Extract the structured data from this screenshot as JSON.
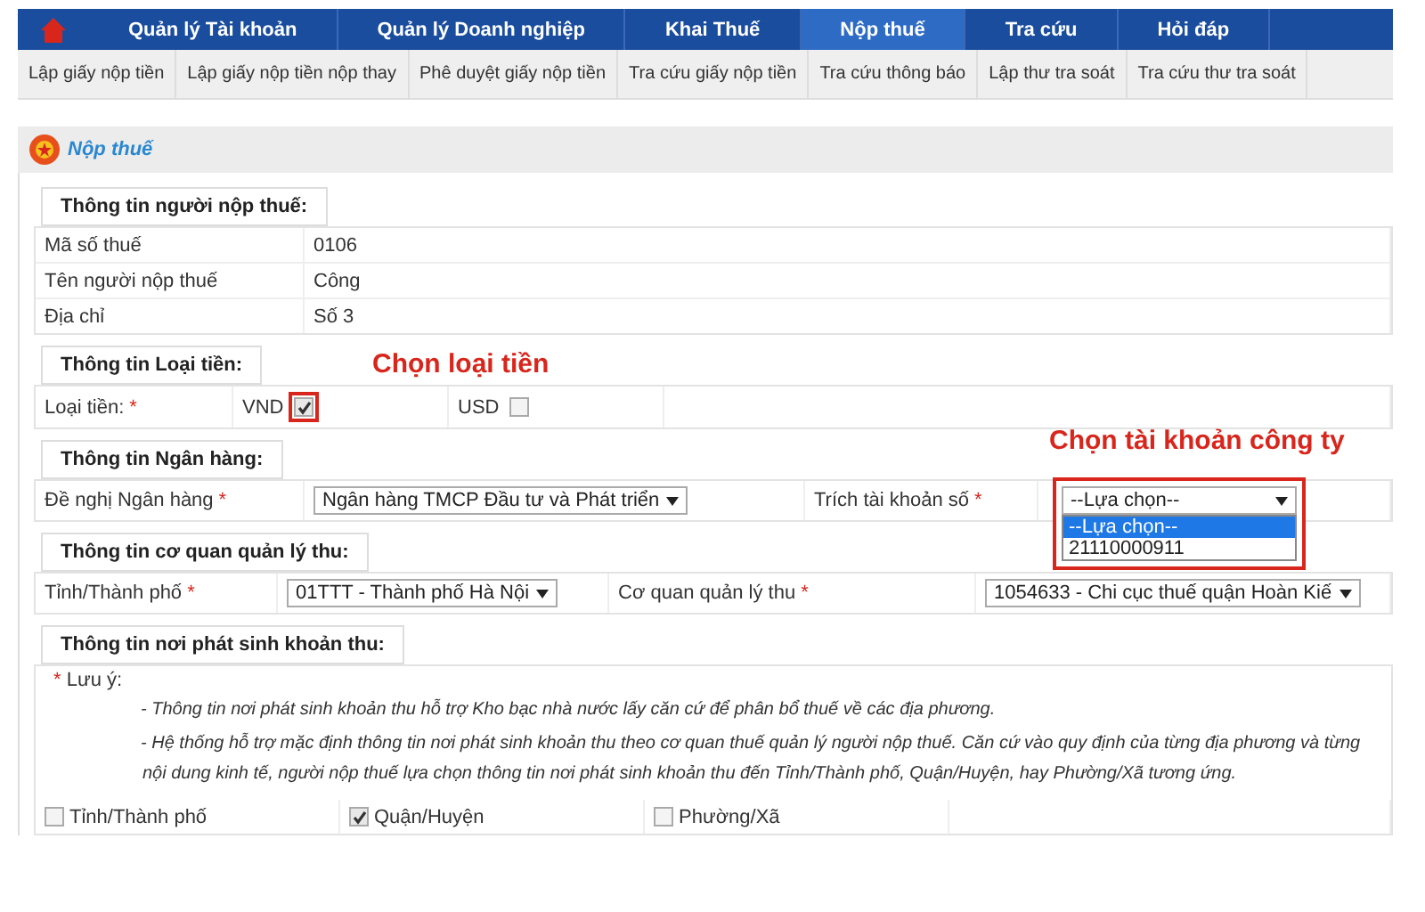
{
  "nav": {
    "items": [
      {
        "label": "Quản lý Tài khoản",
        "selected": false
      },
      {
        "label": "Quản lý Doanh nghiệp",
        "selected": false
      },
      {
        "label": "Khai Thuế",
        "selected": false
      },
      {
        "label": "Nộp thuế",
        "selected": true
      },
      {
        "label": "Tra cứu",
        "selected": false
      },
      {
        "label": "Hỏi đáp",
        "selected": false
      }
    ]
  },
  "subnav": [
    "Lập giấy nộp tiền",
    "Lập giấy nộp tiền nộp thay",
    "Phê duyệt giấy nộp tiền",
    "Tra cứu giấy nộp tiền",
    "Tra cứu thông báo",
    "Lập thư tra soát",
    "Tra cứu thư tra soát"
  ],
  "page_title": "Nộp thuế",
  "taxpayer": {
    "title": "Thông tin người nộp thuế:",
    "rows": [
      {
        "label": "Mã số thuế",
        "value": "0106"
      },
      {
        "label": "Tên người nộp thuế",
        "value": "Công"
      },
      {
        "label": "Địa chỉ",
        "value": "Số 3"
      }
    ]
  },
  "currency": {
    "title": "Thông tin Loại tiền:",
    "label": "Loại tiền:",
    "mark": "*",
    "annotation": "Chọn loại tiền",
    "options": [
      {
        "label": "VND",
        "checked": true
      },
      {
        "label": "USD",
        "checked": false
      }
    ]
  },
  "bank": {
    "title": "Thông tin Ngân hàng:",
    "annotation": "Chọn tài khoản công ty",
    "bank_field": {
      "label": "Đề nghị Ngân hàng",
      "mark": "*",
      "value": "Ngân hàng TMCP Đầu tư và Phát triển"
    },
    "account_field": {
      "label": "Trích tài khoản số",
      "mark": "*",
      "value": "--Lựa chọn--",
      "options": [
        {
          "label": "--Lựa chọn--",
          "selected": true
        },
        {
          "label": "21110000911",
          "selected": false
        }
      ]
    }
  },
  "agency": {
    "title": "Thông tin cơ quan quản lý thu:",
    "fields": [
      {
        "label": "Tỉnh/Thành phố",
        "mark": "*",
        "value": "01TTT - Thành phố Hà Nội"
      },
      {
        "label": "Cơ quan quản lý thu",
        "mark": "*",
        "value": "1054633 - Chi cục thuế quận Hoàn Kiế"
      }
    ]
  },
  "origin": {
    "title": "Thông tin nơi phát sinh khoản thu:",
    "note_mark": "*",
    "note_label": "Lưu ý:",
    "notes": [
      "- Thông tin nơi phát sinh khoản thu hỗ trợ Kho bạc nhà nước lấy căn cứ để phân bổ thuế về các địa phương.",
      "- Hệ thống hỗ trợ mặc định thông tin nơi phát sinh khoản thu theo cơ quan thuế quản lý người nộp thuế. Căn cứ vào quy định của từng địa phương và từng nội dung kinh tế, người nộp thuế lựa chọn thông tin nơi phát sinh khoản thu đến Tỉnh/Thành phố, Quận/Huyện, hay Phường/Xã tương ứng."
    ],
    "options": [
      {
        "label": "Tỉnh/Thành phố",
        "checked": false
      },
      {
        "label": "Quận/Huyện",
        "checked": true
      },
      {
        "label": "Phường/Xã",
        "checked": false
      }
    ]
  }
}
